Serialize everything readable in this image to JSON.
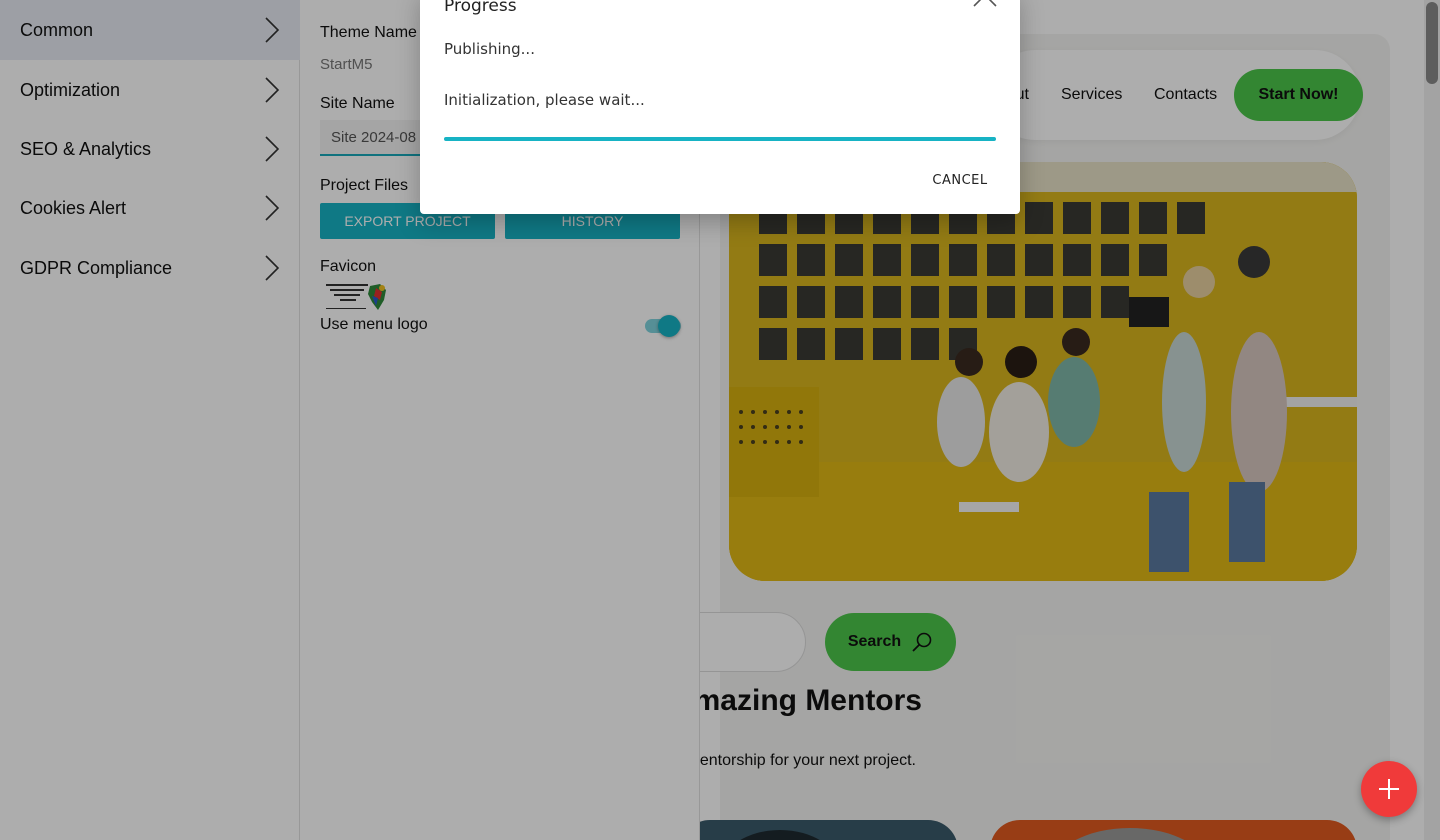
{
  "sidebar": {
    "items": [
      {
        "label": "Common",
        "active": true
      },
      {
        "label": "Optimization"
      },
      {
        "label": "SEO & Analytics"
      },
      {
        "label": "Cookies Alert"
      },
      {
        "label": "GDPR Compliance"
      }
    ]
  },
  "settings": {
    "theme_name_label": "Theme Name",
    "theme_name_value": "StartM5",
    "site_name_label": "Site Name",
    "site_name_value": "Site 2024-08",
    "project_files_label": "Project Files",
    "export_button": "EXPORT PROJECT",
    "history_button": "HISTORY",
    "favicon_label": "Favicon",
    "favicon_logo_text": "AFRICA PROJECTS DEVELOPMENT CENTRE",
    "use_menu_logo_label": "Use menu logo",
    "use_menu_logo_on": true
  },
  "preview": {
    "nav": {
      "about_partial": "ut",
      "services": "Services",
      "contacts": "Contacts",
      "cta": "Start Now!"
    },
    "search_button": "Search",
    "heading_partial": "Amazing Mentors",
    "subtext_partial": "nentorship for your next project.",
    "accent_color": "#4cc64a"
  },
  "dialog": {
    "title": "Progress",
    "status": "Publishing...",
    "detail": "Initialization, please wait...",
    "progress_fraction": 1.0,
    "cancel_label": "CANCEL",
    "accent_color": "#17b3c4"
  },
  "fab": {
    "icon": "plus-icon",
    "color": "#f03a3a"
  }
}
